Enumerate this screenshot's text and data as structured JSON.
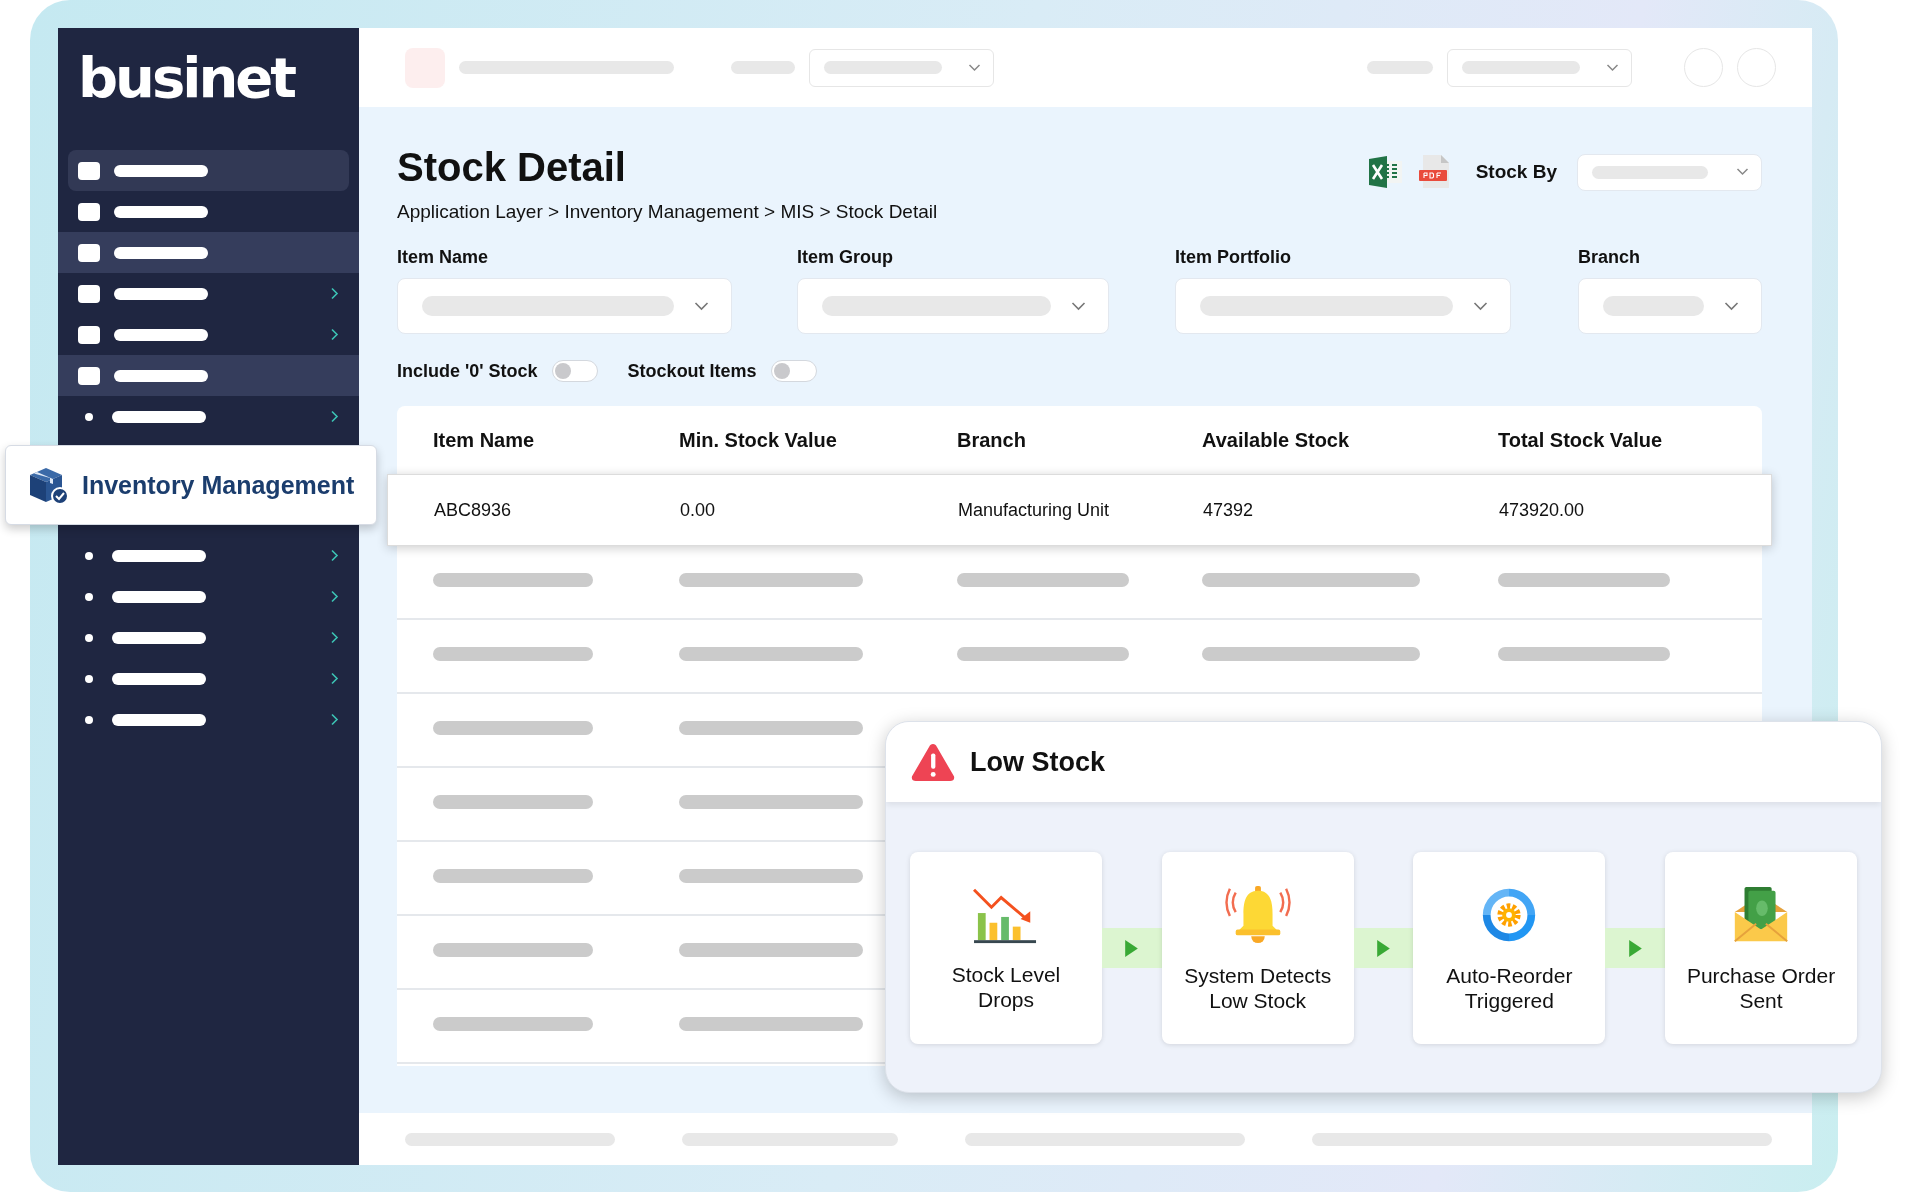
{
  "logo": {
    "text": "businet"
  },
  "sidebar": {
    "items": [
      {
        "kind": "square",
        "selected": true,
        "highlighted": false,
        "has_submenu": false
      },
      {
        "kind": "square",
        "selected": false,
        "highlighted": false,
        "has_submenu": false
      },
      {
        "kind": "square",
        "selected": false,
        "highlighted": true,
        "has_submenu": false
      },
      {
        "kind": "square",
        "selected": false,
        "highlighted": false,
        "has_submenu": true
      },
      {
        "kind": "square",
        "selected": false,
        "highlighted": false,
        "has_submenu": true
      },
      {
        "kind": "square",
        "selected": false,
        "highlighted": true,
        "has_submenu": false
      },
      {
        "kind": "dot",
        "selected": false,
        "highlighted": false,
        "has_submenu": true
      }
    ],
    "callout": {
      "label": "Inventory Management"
    },
    "sub_items": [
      {
        "kind": "dot",
        "selected": false,
        "highlighted": false,
        "has_submenu": true
      },
      {
        "kind": "dot",
        "selected": false,
        "highlighted": false,
        "has_submenu": true
      },
      {
        "kind": "dot",
        "selected": false,
        "highlighted": false,
        "has_submenu": true
      },
      {
        "kind": "dot",
        "selected": false,
        "highlighted": false,
        "has_submenu": true
      },
      {
        "kind": "dot",
        "selected": false,
        "highlighted": false,
        "has_submenu": true
      }
    ]
  },
  "page": {
    "title": "Stock Detail",
    "breadcrumb": "Application Layer > Inventory Management > MIS > Stock Detail",
    "stock_by_label": "Stock By"
  },
  "filters": [
    {
      "label": "Item Name"
    },
    {
      "label": "Item Group"
    },
    {
      "label": "Item Portfolio"
    },
    {
      "label": "Branch"
    }
  ],
  "toggles": [
    {
      "label": "Include '0' Stock",
      "on": false
    },
    {
      "label": "Stockout Items",
      "on": false
    }
  ],
  "table": {
    "columns": [
      "Item Name",
      "Min. Stock Value",
      "Branch",
      "Available Stock",
      "Total Stock Value"
    ],
    "rows": [
      [
        "ABC8936",
        "0.00",
        "Manufacturing Unit",
        "47392",
        "473920.00"
      ]
    ]
  },
  "low_stock": {
    "title": "Low Stock",
    "steps": [
      {
        "kind": "chart",
        "label": "Stock Level Drops"
      },
      {
        "kind": "bell",
        "label": "System Detects Low Stock"
      },
      {
        "kind": "reorder",
        "label": "Auto-Reorder Triggered"
      },
      {
        "kind": "envelope",
        "label": "Purchase Order Sent"
      }
    ]
  }
}
